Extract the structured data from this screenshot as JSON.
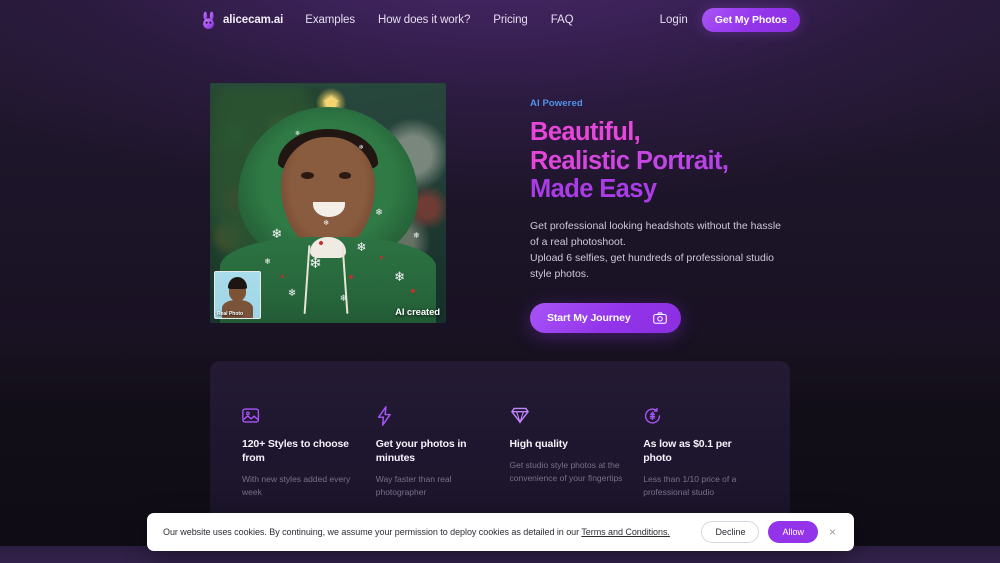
{
  "brand": {
    "name": "alicecam.ai",
    "logo_icon": "rabbit-icon"
  },
  "nav": {
    "links": [
      {
        "label": "Examples"
      },
      {
        "label": "How does it work?"
      },
      {
        "label": "Pricing"
      },
      {
        "label": "FAQ"
      }
    ],
    "login_label": "Login",
    "cta_label": "Get My Photos"
  },
  "hero": {
    "eyebrow": "AI Powered",
    "headline_line1": "Beautiful,",
    "headline_line2": "Realistic Portrait,",
    "headline_line3": "Made Easy",
    "sub_line1": "Get professional looking headshots without the hassle of a real photoshoot.",
    "sub_line2": "Upload 6 selfies, get hundreds of professional studio style photos.",
    "cta_label": "Start My Journey",
    "cta_icon": "camera-icon",
    "image": {
      "ai_label": "AI created",
      "thumb_label": "Real Photo"
    }
  },
  "features": [
    {
      "icon": "image-gallery-icon",
      "title": "120+ Styles to choose from",
      "desc": "With new styles added every week"
    },
    {
      "icon": "lightning-bolt-icon",
      "title": "Get your photos in minutes",
      "desc": "Way faster than real photographer"
    },
    {
      "icon": "diamond-icon",
      "title": "High quality",
      "desc": "Get studio style photos at the convenience of your fingertips"
    },
    {
      "icon": "currency-circle-icon",
      "title": "As low as $0.1 per photo",
      "desc": "Less than 1/10 price of a professional studio"
    }
  ],
  "cookie": {
    "message": "Our website uses cookies. By continuing, we assume your permission to deploy cookies as detailed in our ",
    "link_label": "Terms and Conditions.",
    "decline_label": "Decline",
    "allow_label": "Allow",
    "close_icon": "close-icon"
  },
  "colors": {
    "accent_purple": "#9333ea",
    "accent_purple_light": "#a855f7",
    "headline_pink": "#e646d9",
    "eyebrow_blue": "#4f93e8",
    "page_bg": "#1d1529"
  }
}
